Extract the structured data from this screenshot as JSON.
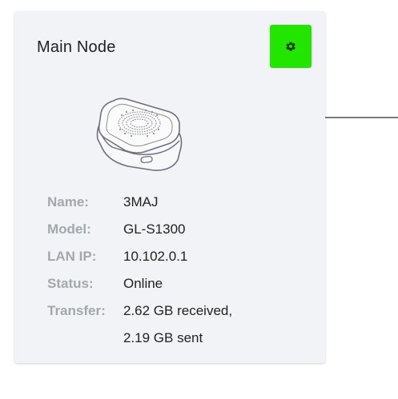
{
  "card": {
    "title": "Main Node",
    "settings_icon": "gear-icon",
    "device_image": "router-device-illustration"
  },
  "info": [
    {
      "label": "Name:",
      "value": "3MAJ"
    },
    {
      "label": "Model:",
      "value": "GL-S1300"
    },
    {
      "label": "LAN IP:",
      "value": "10.102.0.1"
    },
    {
      "label": "Status:",
      "value": "Online"
    },
    {
      "label": "Transfer:",
      "value": "2.62 GB received,"
    },
    {
      "label": "",
      "value": "2.19 GB sent"
    }
  ],
  "colors": {
    "card_background": "#f1f3f6",
    "settings_button": "#22e600",
    "label_text": "#a3a7ae",
    "value_text": "#222222",
    "connector": "#7a7a7a"
  }
}
